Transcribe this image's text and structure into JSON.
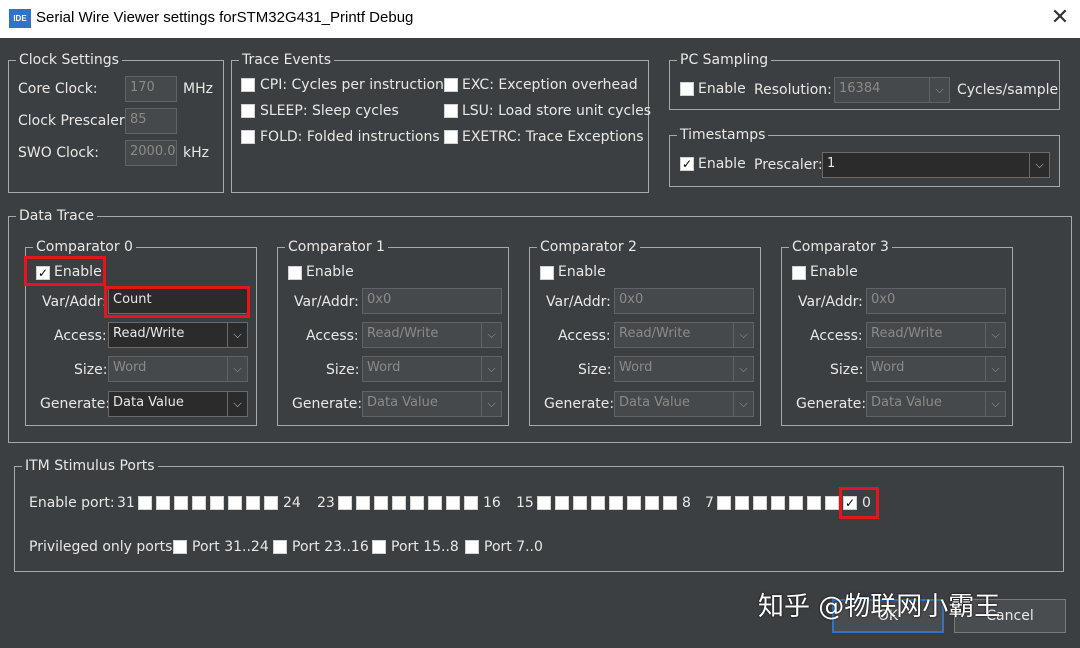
{
  "window": {
    "title": "Serial Wire Viewer settings forSTM32G431_Printf Debug",
    "icon_text": "IDE",
    "close_glyph": "✕"
  },
  "clock": {
    "legend": "Clock Settings",
    "core_label": "Core Clock:",
    "core_value": "170",
    "core_unit": "MHz",
    "prescaler_label": "Clock Prescaler:",
    "prescaler_value": "85",
    "swo_label": "SWO Clock:",
    "swo_value": "2000.0",
    "swo_unit": "kHz"
  },
  "trace_events": {
    "legend": "Trace Events",
    "items": [
      {
        "label": "CPI: Cycles per instruction",
        "checked": false
      },
      {
        "label": "SLEEP: Sleep cycles",
        "checked": false
      },
      {
        "label": "FOLD: Folded instructions",
        "checked": false
      },
      {
        "label": "EXC: Exception overhead",
        "checked": false
      },
      {
        "label": "LSU: Load store unit cycles",
        "checked": false
      },
      {
        "label": "EXETRC: Trace Exceptions",
        "checked": false
      }
    ]
  },
  "pc_sampling": {
    "legend": "PC Sampling",
    "enable_label": "Enable",
    "enable_checked": false,
    "resolution_label": "Resolution:",
    "resolution_value": "16384",
    "unit": "Cycles/sample"
  },
  "timestamps": {
    "legend": "Timestamps",
    "enable_label": "Enable",
    "enable_checked": true,
    "prescaler_label": "Prescaler:",
    "prescaler_value": "1"
  },
  "data_trace": {
    "legend": "Data Trace",
    "comparators": [
      {
        "title": "Comparator 0",
        "enable_label": "Enable",
        "enabled": true,
        "var_label": "Var/Addr:",
        "var_value": "Count",
        "access_label": "Access:",
        "access_value": "Read/Write",
        "size_label": "Size:",
        "size_value": "Word",
        "generate_label": "Generate:",
        "generate_value": "Data Value"
      },
      {
        "title": "Comparator 1",
        "enable_label": "Enable",
        "enabled": false,
        "var_label": "Var/Addr:",
        "var_value": "0x0",
        "access_label": "Access:",
        "access_value": "Read/Write",
        "size_label": "Size:",
        "size_value": "Word",
        "generate_label": "Generate:",
        "generate_value": "Data Value"
      },
      {
        "title": "Comparator 2",
        "enable_label": "Enable",
        "enabled": false,
        "var_label": "Var/Addr:",
        "var_value": "0x0",
        "access_label": "Access:",
        "access_value": "Read/Write",
        "size_label": "Size:",
        "size_value": "Word",
        "generate_label": "Generate:",
        "generate_value": "Data Value"
      },
      {
        "title": "Comparator 3",
        "enable_label": "Enable",
        "enabled": false,
        "var_label": "Var/Addr:",
        "var_value": "0x0",
        "access_label": "Access:",
        "access_value": "Read/Write",
        "size_label": "Size:",
        "size_value": "Word",
        "generate_label": "Generate:",
        "generate_value": "Data Value"
      }
    ]
  },
  "itm": {
    "legend": "ITM Stimulus Ports",
    "enable_port_label": "Enable port:",
    "groups": [
      {
        "start": "31",
        "end": "24",
        "checked_port0": false
      },
      {
        "start": "23",
        "end": "16",
        "checked_port0": false
      },
      {
        "start": "15",
        "end": "8",
        "checked_port0": false
      },
      {
        "start": "7",
        "end": "0",
        "checked_port0": true
      }
    ],
    "privileged_label": "Privileged only ports:",
    "privileged": [
      "Port 31..24",
      "Port 23..16",
      "Port 15..8",
      "Port 7..0"
    ]
  },
  "buttons": {
    "ok": "OK",
    "cancel": "Cancel"
  },
  "watermark": "知乎 @物联网小霸王",
  "colors": {
    "accent": "#2f74c9",
    "highlight": "#e3161f",
    "background": "#3c3f41"
  }
}
